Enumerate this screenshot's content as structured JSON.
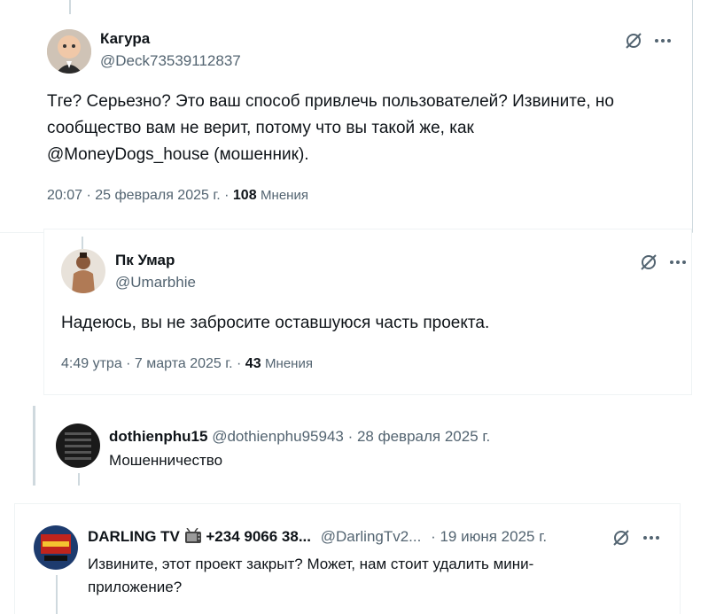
{
  "tweet1": {
    "name": "Кагура",
    "handle": "@Deck73539112837",
    "text_line1": "Тге? Серьезно? Это ваш способ привлечь пользователей? Извините, но",
    "text_line2": "сообщество вам не верит, потому что вы такой же, как",
    "text_line3": "@MoneyDogs_house (мошенник).",
    "time": "20:07 · 25 февраля 2025 г. · ",
    "views_count": "108",
    "views_label": "Мнения"
  },
  "tweet2": {
    "name": "Пк Умар",
    "handle": "@Umarbhie",
    "text": "Надеюсь, вы не забросите оставшуюся часть проекта.",
    "time": "4:49 утра · 7 марта 2025 г. · ",
    "views_count": "43",
    "views_label": "Мнения"
  },
  "reply1": {
    "name": "dothienphu15",
    "handle": "@dothienphu95943",
    "date": "· 28 февраля 2025 г.",
    "text": "Мошенничество"
  },
  "reply2": {
    "name": "DARLING TV",
    "name_extra": "+234 9066 38...",
    "handle": "@DarlingTv2...",
    "date": "· 19 июня 2025 г.",
    "text_line1": "Извините, этот проект закрыт? Может, нам стоит удалить мини-",
    "text_line2": "приложение?"
  },
  "icons": {
    "grok": "grok-icon",
    "more": "more-icon",
    "tv": "tv-emoji-icon"
  },
  "colors": {
    "text": "#0f1419",
    "secondary": "#536471",
    "border": "#cfd9de"
  }
}
